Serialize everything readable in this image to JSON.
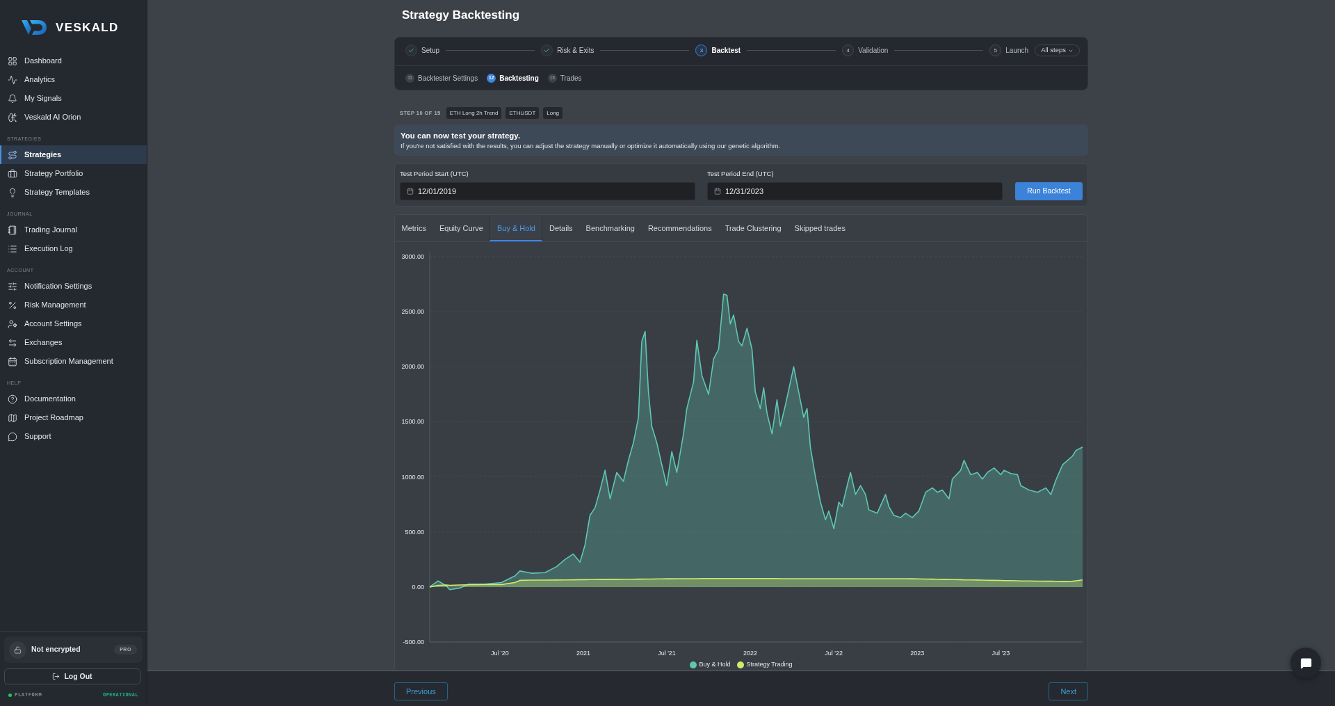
{
  "sidebar": {
    "logo": "VESKALD",
    "sections": [
      {
        "items": [
          {
            "label": "Dashboard",
            "selected": false
          },
          {
            "label": "Analytics",
            "selected": false
          },
          {
            "label": "My Signals",
            "selected": false
          },
          {
            "label": "Veskald AI Orion",
            "selected": false
          }
        ]
      },
      {
        "title": "STRATEGIES",
        "items": [
          {
            "label": "Strategies",
            "selected": true
          },
          {
            "label": "Strategy Portfolio",
            "selected": false
          },
          {
            "label": "Strategy Templates",
            "selected": false
          }
        ]
      },
      {
        "title": "JOURNAL",
        "items": [
          {
            "label": "Trading Journal",
            "selected": false
          },
          {
            "label": "Execution Log",
            "selected": false
          }
        ]
      },
      {
        "title": "ACCOUNT",
        "items": [
          {
            "label": "Notification Settings",
            "selected": false
          },
          {
            "label": "Risk Management",
            "selected": false
          },
          {
            "label": "Account Settings",
            "selected": false
          },
          {
            "label": "Exchanges",
            "selected": false
          },
          {
            "label": "Subscription Management",
            "selected": false
          }
        ]
      },
      {
        "title": "HELP",
        "items": [
          {
            "label": "Documentation",
            "selected": false
          },
          {
            "label": "Project Roadmap",
            "selected": false
          },
          {
            "label": "Support",
            "selected": false
          }
        ]
      }
    ],
    "security": {
      "status": "Not encrypted",
      "plan": "PRO"
    },
    "logout": "Log Out",
    "platform": {
      "label": "PLATFORM",
      "status": "OPERATIONAL"
    }
  },
  "page_title": "Strategy Backtesting",
  "stepper": {
    "steps": [
      {
        "label": "Setup",
        "done": true,
        "selected": false
      },
      {
        "label": "Risk & Exits",
        "done": true,
        "selected": false
      },
      {
        "number": "3",
        "label": "Backtest",
        "done": false,
        "selected": true
      },
      {
        "number": "4",
        "label": "Validation",
        "done": false,
        "selected": false
      },
      {
        "number": "5",
        "label": "Launch",
        "done": false,
        "selected": false
      }
    ],
    "menu": "All steps",
    "substeps": [
      {
        "number": "11",
        "label": "Backtester Settings",
        "selected": false
      },
      {
        "number": "12",
        "label": "Backtesting",
        "selected": true
      },
      {
        "number": "13",
        "label": "Trades",
        "selected": false
      }
    ]
  },
  "step_info": {
    "progress": "STEP 10 OF 15",
    "tags": [
      "ETH Long 2h Trend",
      "ETHUSDT",
      "Long"
    ]
  },
  "notice": {
    "title": "You can now test your strategy.",
    "text": "If you're not satisfied with the results, you can adjust the strategy manually or optimize it automatically using our genetic algorithm."
  },
  "test_period": {
    "start": {
      "label": "Test Period Start (UTC)",
      "value": "12/01/2019"
    },
    "end": {
      "label": "Test Period End (UTC)",
      "value": "12/31/2023"
    },
    "run_button": "Run Backtest"
  },
  "results": {
    "tabs": [
      {
        "label": "Metrics",
        "selected": false
      },
      {
        "label": "Equity Curve",
        "selected": false
      },
      {
        "label": "Buy & Hold",
        "selected": true
      },
      {
        "label": "Details",
        "selected": false
      },
      {
        "label": "Benchmarking",
        "selected": false
      },
      {
        "label": "Recommendations",
        "selected": false
      },
      {
        "label": "Trade Clustering",
        "selected": false
      },
      {
        "label": "Skipped trades",
        "selected": false
      }
    ],
    "chart_data": {
      "type": "area",
      "grid": true,
      "legend": "bottom",
      "xlim": [
        2020.08,
        2023.99
      ],
      "ylim": [
        -500,
        3000
      ],
      "xticks": [
        {
          "value": 2020.5,
          "label": "Jul '20"
        },
        {
          "value": 2021,
          "label": "2021"
        },
        {
          "value": 2021.5,
          "label": "Jul '21"
        },
        {
          "value": 2022,
          "label": "2022"
        },
        {
          "value": 2022.5,
          "label": "Jul '22"
        },
        {
          "value": 2023,
          "label": "2023"
        },
        {
          "value": 2023.5,
          "label": "Jul '23"
        }
      ],
      "yticks": [
        {
          "value": 3000,
          "label": "3000.00"
        },
        {
          "value": 2500,
          "label": "2500.00"
        },
        {
          "value": 2000,
          "label": "2000.00"
        },
        {
          "value": 1500,
          "label": "1500.00"
        },
        {
          "value": 1000,
          "label": "1000.00"
        },
        {
          "value": 500,
          "label": "500.00"
        },
        {
          "value": 0,
          "label": "0.00"
        },
        {
          "value": -500,
          "label": "-500.00"
        }
      ],
      "x": [
        2020.08,
        2020.13,
        2020.18,
        2020.2,
        2020.26,
        2020.31,
        2020.41,
        2020.51,
        2020.59,
        2020.62,
        2020.69,
        2020.77,
        2020.84,
        2020.89,
        2020.94,
        2020.98,
        2021.01,
        2021.04,
        2021.07,
        2021.1,
        2021.13,
        2021.16,
        2021.2,
        2021.24,
        2021.27,
        2021.3,
        2021.33,
        2021.35,
        2021.37,
        2021.39,
        2021.41,
        2021.44,
        2021.47,
        2021.5,
        2021.53,
        2021.56,
        2021.6,
        2021.62,
        2021.66,
        2021.68,
        2021.71,
        2021.75,
        2021.78,
        2021.81,
        2021.84,
        2021.86,
        2021.88,
        2021.9,
        2021.93,
        2021.95,
        2021.98,
        2022.01,
        2022.03,
        2022.06,
        2022.08,
        2022.1,
        2022.13,
        2022.16,
        2022.18,
        2022.21,
        2022.26,
        2022.29,
        2022.32,
        2022.34,
        2022.36,
        2022.39,
        2022.42,
        2022.45,
        2022.47,
        2022.5,
        2022.53,
        2022.55,
        2022.58,
        2022.6,
        2022.63,
        2022.66,
        2022.69,
        2022.71,
        2022.76,
        2022.81,
        2022.83,
        2022.86,
        2022.9,
        2022.93,
        2022.97,
        2023.01,
        2023.05,
        2023.09,
        2023.12,
        2023.15,
        2023.19,
        2023.21,
        2023.26,
        2023.28,
        2023.32,
        2023.36,
        2023.39,
        2023.42,
        2023.46,
        2023.5,
        2023.52,
        2023.56,
        2023.6,
        2023.62,
        2023.67,
        2023.72,
        2023.77,
        2023.8,
        2023.83,
        2023.87,
        2023.9,
        2023.93,
        2023.95,
        2023.99
      ],
      "series": [
        {
          "name": "Buy & Hold",
          "color": "#5fc7b4",
          "values": [
            0,
            55,
            10,
            -25,
            -10,
            25,
            25,
            40,
            100,
            145,
            125,
            130,
            185,
            250,
            300,
            225,
            380,
            650,
            720,
            880,
            1060,
            800,
            1040,
            960,
            1150,
            1310,
            1540,
            2230,
            2320,
            1770,
            1460,
            1310,
            1110,
            920,
            1230,
            1040,
            1390,
            1620,
            1860,
            2240,
            1920,
            1750,
            2070,
            2160,
            2660,
            2650,
            2390,
            2470,
            2230,
            2190,
            2350,
            2160,
            1770,
            1620,
            1810,
            1580,
            1390,
            1700,
            1460,
            1650,
            2000,
            1770,
            1540,
            1620,
            1270,
            1000,
            770,
            610,
            690,
            530,
            770,
            730,
            920,
            1040,
            840,
            920,
            840,
            700,
            670,
            840,
            730,
            650,
            630,
            670,
            630,
            690,
            860,
            900,
            860,
            880,
            800,
            980,
            1060,
            1150,
            1020,
            1040,
            980,
            1040,
            1080,
            1020,
            1060,
            1030,
            1020,
            920,
            880,
            860,
            900,
            840,
            970,
            1110,
            1150,
            1190,
            1240,
            1270
          ]
        },
        {
          "name": "Strategy Trading",
          "color": "#d4ea6b",
          "values": [
            0,
            15,
            18,
            15,
            18,
            20,
            22,
            22,
            40,
            60,
            62,
            62,
            63,
            64,
            65,
            66,
            66,
            67,
            67,
            68,
            68,
            69,
            69,
            70,
            70,
            70,
            71,
            71,
            72,
            72,
            72,
            73,
            73,
            74,
            74,
            75,
            75,
            75,
            75,
            75,
            76,
            76,
            76,
            76,
            77,
            77,
            77,
            77,
            77,
            76,
            76,
            76,
            76,
            76,
            76,
            76,
            76,
            76,
            75,
            75,
            75,
            75,
            75,
            75,
            75,
            75,
            75,
            75,
            75,
            75,
            75,
            75,
            75,
            75,
            75,
            75,
            75,
            75,
            75,
            75,
            75,
            75,
            75,
            75,
            74,
            73,
            72,
            71,
            70,
            69,
            68,
            67,
            66,
            65,
            64,
            63,
            62,
            61,
            60,
            59,
            58,
            57,
            56,
            55,
            54,
            53,
            52,
            52,
            51,
            50,
            50,
            52,
            56,
            64
          ]
        }
      ]
    }
  },
  "footer": {
    "previous": "Previous",
    "next": "Next"
  }
}
